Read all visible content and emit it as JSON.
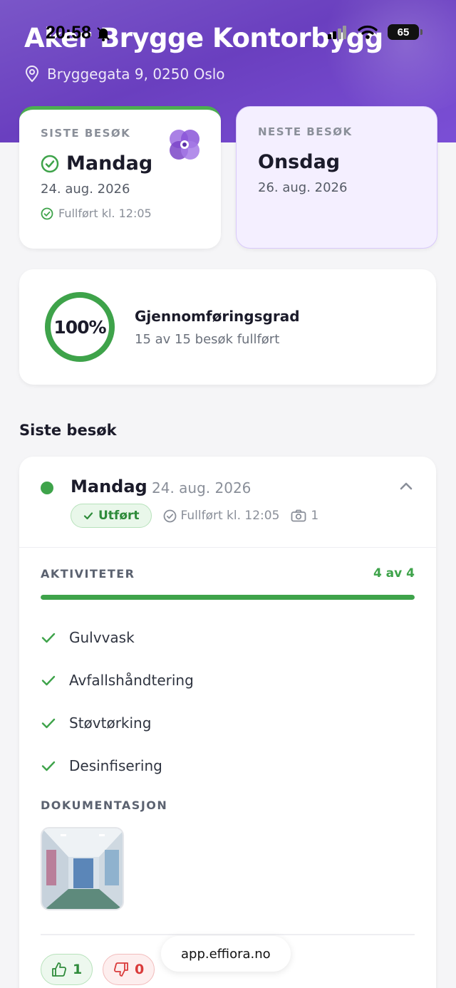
{
  "status_bar": {
    "time": "20:58",
    "battery": "65"
  },
  "header": {
    "title": "Aker Brygge Kontorbygg",
    "address": "Bryggegata 9, 0250 Oslo"
  },
  "last_visit": {
    "label": "SISTE BESØK",
    "day": "Mandag",
    "date": "24. aug. 2026",
    "completed": "Fullført kl. 12:05"
  },
  "next_visit": {
    "label": "NESTE BESØK",
    "day": "Onsdag",
    "date": "26. aug. 2026"
  },
  "completion_rate": {
    "percent_label": "100%",
    "percent": 100,
    "title": "Gjennomføringsgrad",
    "subtitle": "15 av 15 besøk fullført"
  },
  "recent_section": {
    "title": "Siste besøk"
  },
  "visit_detail": {
    "day": "Mandag",
    "date": "24. aug. 2026",
    "status_badge": "Utført",
    "completed": "Fullført kl. 12:05",
    "photo_count": "1",
    "activities_label": "AKTIVITETER",
    "activities_count": "4 av 4",
    "activities_progress": 1.0,
    "activities": [
      "Gulvvask",
      "Avfallshåndtering",
      "Støvtørking",
      "Desinfisering"
    ],
    "documentation_label": "DOKUMENTASJON",
    "likes": "1",
    "dislikes": "0"
  },
  "browser": {
    "url": "app.effiora.no"
  },
  "colors": {
    "brand_purple": "#6a3fbf",
    "success_green": "#3ea34a",
    "danger_red": "#d93a3a"
  }
}
